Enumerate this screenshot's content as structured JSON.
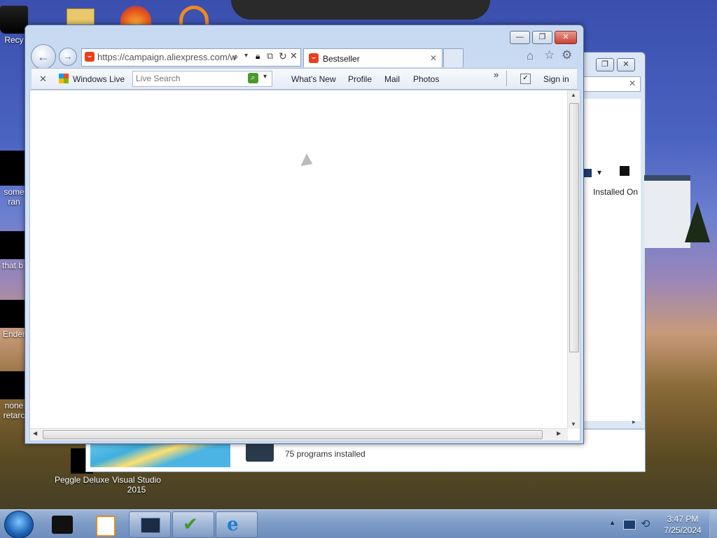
{
  "desktop": {
    "icons": [
      {
        "label": "Recy"
      },
      {
        "label": "some"
      },
      {
        "label": "ran"
      },
      {
        "label": "that b"
      },
      {
        "label": "Ender"
      },
      {
        "label": "none"
      },
      {
        "label": "retarc"
      },
      {
        "label": "Peggle Deluxe"
      },
      {
        "label": "Visual Studio 2015"
      }
    ]
  },
  "browser": {
    "address": {
      "url": "https://campaign.aliexpress.com/w"
    },
    "tab": {
      "title": "Bestseller"
    },
    "command_bar": {
      "windows_live": "Windows Live",
      "search_placeholder": "Live Search",
      "links": [
        "What's New",
        "Profile",
        "Mail",
        "Photos"
      ],
      "more": "»",
      "sign_in": "Sign in"
    },
    "controls": {
      "minimize": "—",
      "restore": "❐",
      "close": "✕"
    }
  },
  "back_window": {
    "column_header": "Installed On",
    "status": "75 programs installed"
  },
  "taskbar": {
    "clock_time": "3:47 PM",
    "clock_date": "7/25/2024"
  },
  "colors": {
    "accent": "#e8401c",
    "window_frame": "#c6d9f1",
    "close_red": "#c94235"
  }
}
